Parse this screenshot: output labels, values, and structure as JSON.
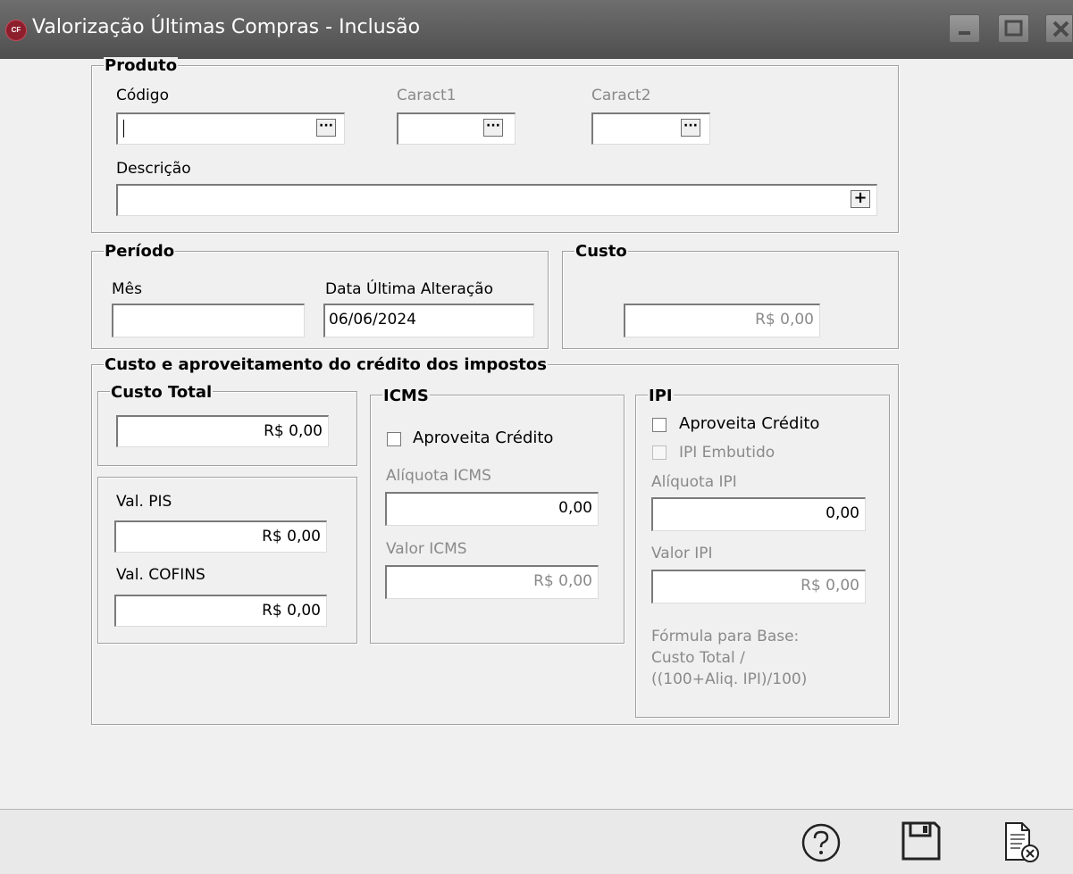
{
  "window": {
    "title": "Valorização Últimas Compras - Inclusão",
    "icon": "app-logo-icon",
    "icon_text": "CF"
  },
  "produto": {
    "legend": "Produto",
    "codigo_label": "Código",
    "codigo_value": "",
    "caract1_label": "Caract1",
    "caract1_value": "",
    "caract2_label": "Caract2",
    "caract2_value": "",
    "descricao_label": "Descrição",
    "descricao_value": "",
    "lookup_button": "···",
    "expand_button": "+"
  },
  "periodo": {
    "legend": "Período",
    "mes_label": "Mês",
    "mes_value": "",
    "data_label": "Data Última Alteração",
    "data_value": "06/06/2024"
  },
  "custo": {
    "legend": "Custo",
    "value": "R$ 0,00"
  },
  "impostos": {
    "legend": "Custo e aproveitamento do crédito dos impostos",
    "custo_total": {
      "legend": "Custo Total",
      "value": "R$ 0,00"
    },
    "pis_label": "Val. PIS",
    "pis_value": "R$ 0,00",
    "cofins_label": "Val. COFINS",
    "cofins_value": "R$ 0,00",
    "icms": {
      "legend": "ICMS",
      "aproveita_label": "Aproveita Crédito",
      "aproveita_checked": false,
      "aliquota_label": "Alíquota ICMS",
      "aliquota_value": "0,00",
      "valor_label": "Valor ICMS",
      "valor_value": "R$ 0,00"
    },
    "ipi": {
      "legend": "IPI",
      "aproveita_label": "Aproveita Crédito",
      "aproveita_checked": false,
      "embutido_label": "IPI Embutido",
      "embutido_checked": false,
      "aliquota_label": "Alíquota IPI",
      "aliquota_value": "0,00",
      "valor_label": "Valor IPI",
      "valor_value": "R$ 0,00",
      "formula_line1": "Fórmula para Base:",
      "formula_line2": "Custo Total /",
      "formula_line3": "((100+Aliq. IPI)/100)"
    }
  },
  "toolbar": {
    "help_icon": "help-icon",
    "save_icon": "save-icon",
    "cancel_icon": "cancel-document-icon"
  }
}
